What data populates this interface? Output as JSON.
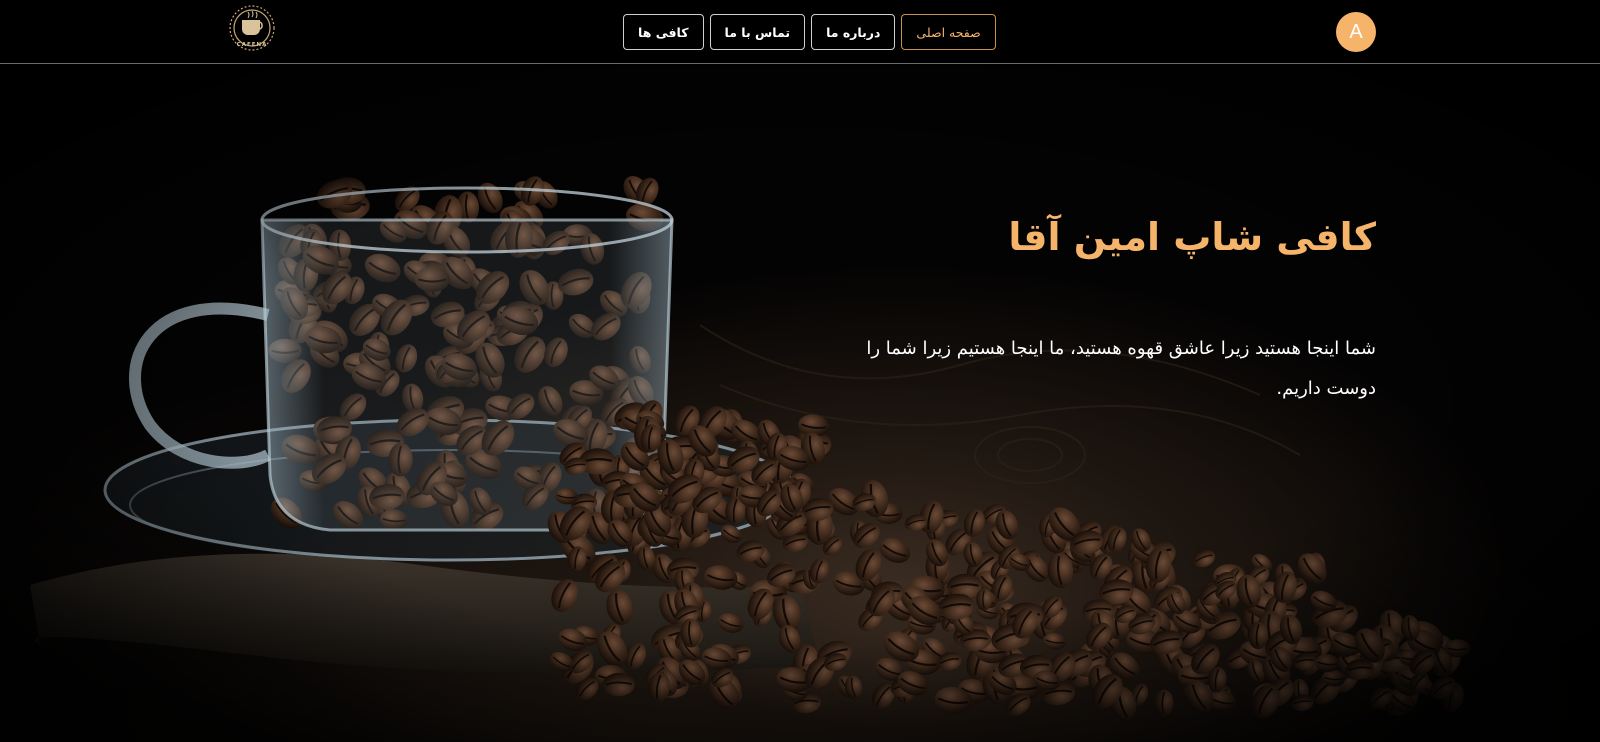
{
  "header": {
    "logo_text": "CAFENA",
    "nav": [
      {
        "label": "صفحه اصلی",
        "active": true
      },
      {
        "label": "درباره ما",
        "active": false
      },
      {
        "label": "تماس با ما",
        "active": false
      },
      {
        "label": "کافی ها",
        "active": false
      }
    ],
    "avatar_letter": "A"
  },
  "hero": {
    "title": "کافی شاپ امین آقا",
    "text": "شما اینجا هستید زیرا عاشق قهوه هستید، ما اینجا هستیم زیرا شما را دوست داریم."
  },
  "colors": {
    "accent": "#f6b46b",
    "background": "#000000",
    "nav_border": "#cfcfcf"
  },
  "icons": {
    "logo": "coffee-cup-gear-logo-icon",
    "hero": "glass-cup-coffee-beans-image"
  }
}
